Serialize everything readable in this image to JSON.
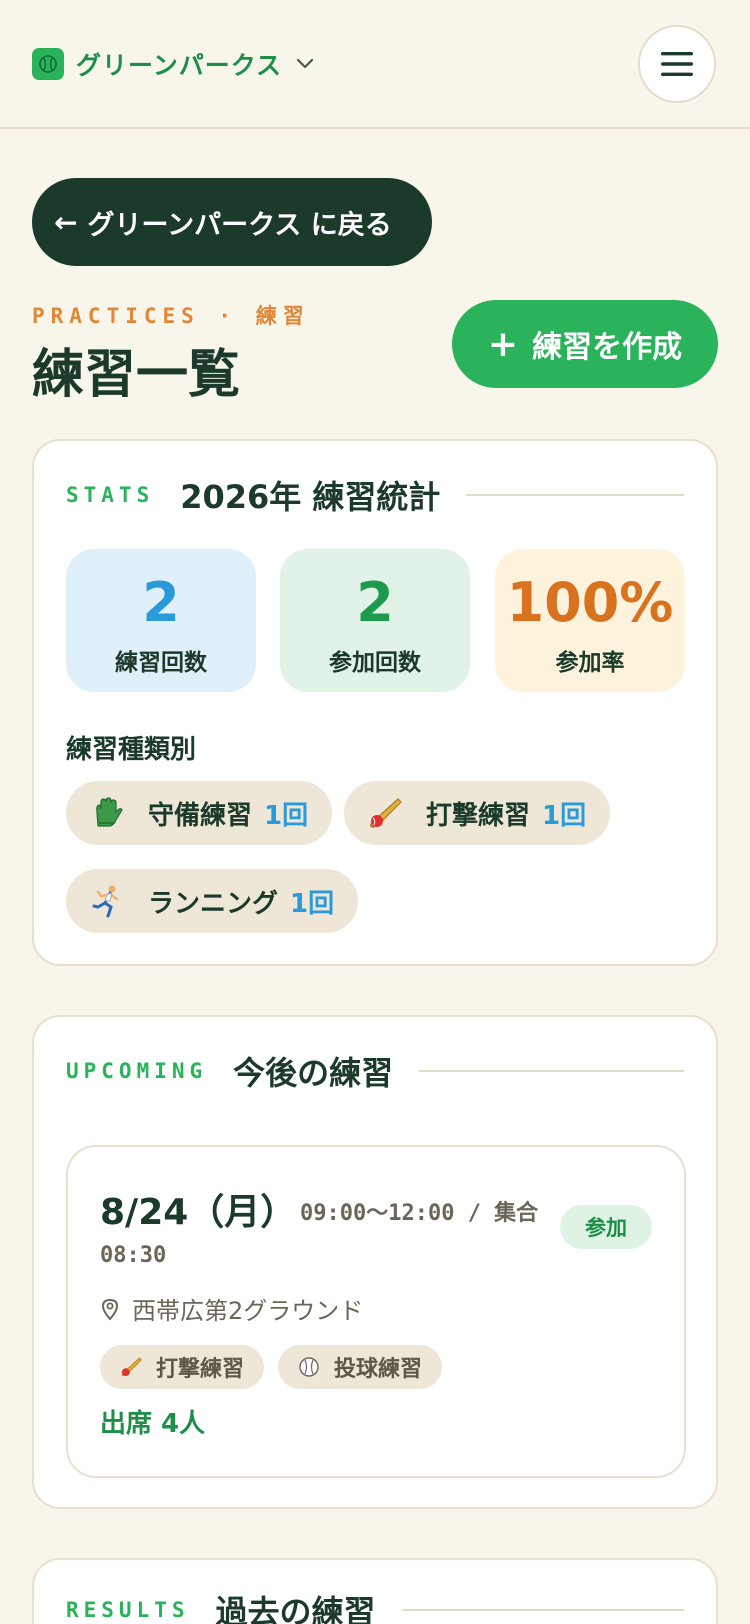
{
  "header": {
    "team_name": "グリーンパークス",
    "logo_icon": "baseball-icon",
    "menu_icon": "hamburger-menu-icon"
  },
  "back_button": {
    "arrow": "←",
    "label": "グリーンパークス に戻る"
  },
  "page": {
    "eyebrow": "PRACTICES · 練習",
    "title": "練習一覧",
    "create_button": {
      "icon": "+",
      "label": "練習を作成"
    }
  },
  "stats": {
    "section_label": "STATS",
    "section_title": "2026年 練習統計",
    "items": [
      {
        "value": "2",
        "label": "練習回数",
        "color": "#2a9ad8",
        "bg": "#e0f0fa"
      },
      {
        "value": "2",
        "label": "参加回数",
        "color": "#1e9a4e",
        "bg": "#e0f3e6"
      },
      {
        "value": "100%",
        "label": "参加率",
        "color": "#d8721e",
        "bg": "#fdf3dd"
      }
    ],
    "types_heading": "練習種類別",
    "types": [
      {
        "label": "守備練習",
        "count": "1回",
        "icon": "glove-icon"
      },
      {
        "label": "打撃練習",
        "count": "1回",
        "icon": "bat-icon"
      },
      {
        "label": "ランニング",
        "count": "1回",
        "icon": "runner-icon"
      }
    ]
  },
  "upcoming": {
    "section_label": "UPCOMING",
    "section_title": "今後の練習",
    "practice": {
      "date": "8/24（月）",
      "time": "09:00〜12:00 / 集合",
      "time2": "08:30",
      "status": "参加",
      "location": "西帯広第2グラウンド",
      "tags": [
        {
          "label": "打撃練習",
          "icon": "bat-icon"
        },
        {
          "label": "投球練習",
          "icon": "baseball-icon"
        }
      ],
      "attendance": "出席 4人"
    }
  },
  "results": {
    "section_label": "RESULTS",
    "section_title": "過去の練習"
  }
}
